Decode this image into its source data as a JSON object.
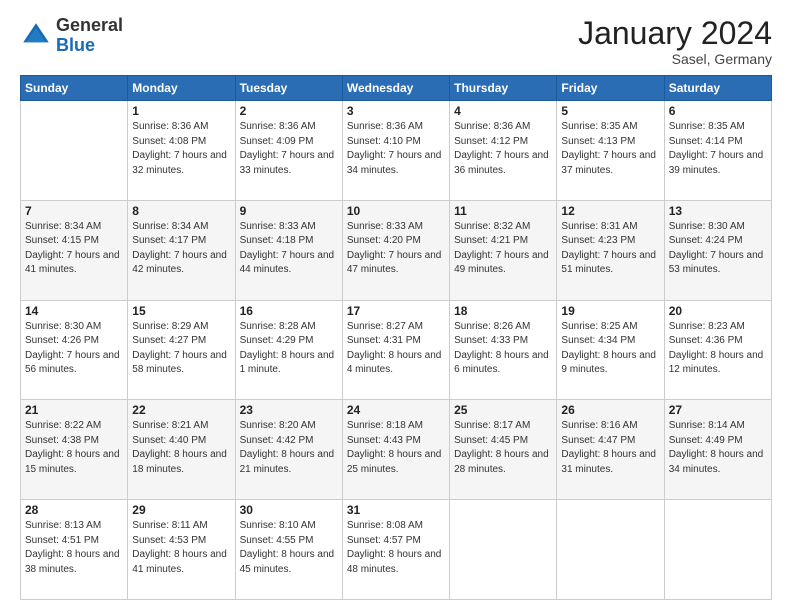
{
  "header": {
    "logo": {
      "general": "General",
      "blue": "Blue"
    },
    "title": "January 2024",
    "subtitle": "Sasel, Germany"
  },
  "calendar": {
    "weekdays": [
      "Sunday",
      "Monday",
      "Tuesday",
      "Wednesday",
      "Thursday",
      "Friday",
      "Saturday"
    ],
    "weeks": [
      [
        {
          "day": "",
          "sunrise": "",
          "sunset": "",
          "daylight": ""
        },
        {
          "day": "1",
          "sunrise": "Sunrise: 8:36 AM",
          "sunset": "Sunset: 4:08 PM",
          "daylight": "Daylight: 7 hours and 32 minutes."
        },
        {
          "day": "2",
          "sunrise": "Sunrise: 8:36 AM",
          "sunset": "Sunset: 4:09 PM",
          "daylight": "Daylight: 7 hours and 33 minutes."
        },
        {
          "day": "3",
          "sunrise": "Sunrise: 8:36 AM",
          "sunset": "Sunset: 4:10 PM",
          "daylight": "Daylight: 7 hours and 34 minutes."
        },
        {
          "day": "4",
          "sunrise": "Sunrise: 8:36 AM",
          "sunset": "Sunset: 4:12 PM",
          "daylight": "Daylight: 7 hours and 36 minutes."
        },
        {
          "day": "5",
          "sunrise": "Sunrise: 8:35 AM",
          "sunset": "Sunset: 4:13 PM",
          "daylight": "Daylight: 7 hours and 37 minutes."
        },
        {
          "day": "6",
          "sunrise": "Sunrise: 8:35 AM",
          "sunset": "Sunset: 4:14 PM",
          "daylight": "Daylight: 7 hours and 39 minutes."
        }
      ],
      [
        {
          "day": "7",
          "sunrise": "Sunrise: 8:34 AM",
          "sunset": "Sunset: 4:15 PM",
          "daylight": "Daylight: 7 hours and 41 minutes."
        },
        {
          "day": "8",
          "sunrise": "Sunrise: 8:34 AM",
          "sunset": "Sunset: 4:17 PM",
          "daylight": "Daylight: 7 hours and 42 minutes."
        },
        {
          "day": "9",
          "sunrise": "Sunrise: 8:33 AM",
          "sunset": "Sunset: 4:18 PM",
          "daylight": "Daylight: 7 hours and 44 minutes."
        },
        {
          "day": "10",
          "sunrise": "Sunrise: 8:33 AM",
          "sunset": "Sunset: 4:20 PM",
          "daylight": "Daylight: 7 hours and 47 minutes."
        },
        {
          "day": "11",
          "sunrise": "Sunrise: 8:32 AM",
          "sunset": "Sunset: 4:21 PM",
          "daylight": "Daylight: 7 hours and 49 minutes."
        },
        {
          "day": "12",
          "sunrise": "Sunrise: 8:31 AM",
          "sunset": "Sunset: 4:23 PM",
          "daylight": "Daylight: 7 hours and 51 minutes."
        },
        {
          "day": "13",
          "sunrise": "Sunrise: 8:30 AM",
          "sunset": "Sunset: 4:24 PM",
          "daylight": "Daylight: 7 hours and 53 minutes."
        }
      ],
      [
        {
          "day": "14",
          "sunrise": "Sunrise: 8:30 AM",
          "sunset": "Sunset: 4:26 PM",
          "daylight": "Daylight: 7 hours and 56 minutes."
        },
        {
          "day": "15",
          "sunrise": "Sunrise: 8:29 AM",
          "sunset": "Sunset: 4:27 PM",
          "daylight": "Daylight: 7 hours and 58 minutes."
        },
        {
          "day": "16",
          "sunrise": "Sunrise: 8:28 AM",
          "sunset": "Sunset: 4:29 PM",
          "daylight": "Daylight: 8 hours and 1 minute."
        },
        {
          "day": "17",
          "sunrise": "Sunrise: 8:27 AM",
          "sunset": "Sunset: 4:31 PM",
          "daylight": "Daylight: 8 hours and 4 minutes."
        },
        {
          "day": "18",
          "sunrise": "Sunrise: 8:26 AM",
          "sunset": "Sunset: 4:33 PM",
          "daylight": "Daylight: 8 hours and 6 minutes."
        },
        {
          "day": "19",
          "sunrise": "Sunrise: 8:25 AM",
          "sunset": "Sunset: 4:34 PM",
          "daylight": "Daylight: 8 hours and 9 minutes."
        },
        {
          "day": "20",
          "sunrise": "Sunrise: 8:23 AM",
          "sunset": "Sunset: 4:36 PM",
          "daylight": "Daylight: 8 hours and 12 minutes."
        }
      ],
      [
        {
          "day": "21",
          "sunrise": "Sunrise: 8:22 AM",
          "sunset": "Sunset: 4:38 PM",
          "daylight": "Daylight: 8 hours and 15 minutes."
        },
        {
          "day": "22",
          "sunrise": "Sunrise: 8:21 AM",
          "sunset": "Sunset: 4:40 PM",
          "daylight": "Daylight: 8 hours and 18 minutes."
        },
        {
          "day": "23",
          "sunrise": "Sunrise: 8:20 AM",
          "sunset": "Sunset: 4:42 PM",
          "daylight": "Daylight: 8 hours and 21 minutes."
        },
        {
          "day": "24",
          "sunrise": "Sunrise: 8:18 AM",
          "sunset": "Sunset: 4:43 PM",
          "daylight": "Daylight: 8 hours and 25 minutes."
        },
        {
          "day": "25",
          "sunrise": "Sunrise: 8:17 AM",
          "sunset": "Sunset: 4:45 PM",
          "daylight": "Daylight: 8 hours and 28 minutes."
        },
        {
          "day": "26",
          "sunrise": "Sunrise: 8:16 AM",
          "sunset": "Sunset: 4:47 PM",
          "daylight": "Daylight: 8 hours and 31 minutes."
        },
        {
          "day": "27",
          "sunrise": "Sunrise: 8:14 AM",
          "sunset": "Sunset: 4:49 PM",
          "daylight": "Daylight: 8 hours and 34 minutes."
        }
      ],
      [
        {
          "day": "28",
          "sunrise": "Sunrise: 8:13 AM",
          "sunset": "Sunset: 4:51 PM",
          "daylight": "Daylight: 8 hours and 38 minutes."
        },
        {
          "day": "29",
          "sunrise": "Sunrise: 8:11 AM",
          "sunset": "Sunset: 4:53 PM",
          "daylight": "Daylight: 8 hours and 41 minutes."
        },
        {
          "day": "30",
          "sunrise": "Sunrise: 8:10 AM",
          "sunset": "Sunset: 4:55 PM",
          "daylight": "Daylight: 8 hours and 45 minutes."
        },
        {
          "day": "31",
          "sunrise": "Sunrise: 8:08 AM",
          "sunset": "Sunset: 4:57 PM",
          "daylight": "Daylight: 8 hours and 48 minutes."
        },
        {
          "day": "",
          "sunrise": "",
          "sunset": "",
          "daylight": ""
        },
        {
          "day": "",
          "sunrise": "",
          "sunset": "",
          "daylight": ""
        },
        {
          "day": "",
          "sunrise": "",
          "sunset": "",
          "daylight": ""
        }
      ]
    ]
  }
}
